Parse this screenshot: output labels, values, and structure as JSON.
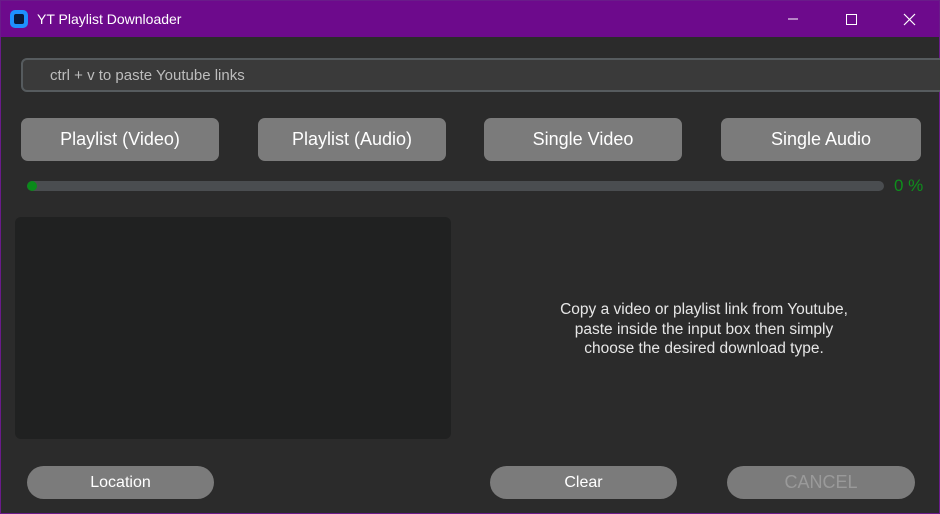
{
  "window": {
    "title": "YT Playlist Downloader",
    "icon": "app-icon",
    "controls": [
      "minimize-icon",
      "maximize-icon",
      "close-icon"
    ],
    "accent_color": "#6d0a8c"
  },
  "url_input": {
    "value": "",
    "placeholder": "ctrl + v to paste Youtube links"
  },
  "download_types": {
    "playlist_video": "Playlist (Video)",
    "playlist_audio": "Playlist (Audio)",
    "single_video": "Single Video",
    "single_audio": "Single Audio"
  },
  "progress": {
    "value": 0,
    "label": "0 %",
    "color": "#0a8a1a"
  },
  "instructions": {
    "line1": "Copy a video or playlist link from Youtube,",
    "line2": "paste inside the input box then simply",
    "line3": "choose the desired download type."
  },
  "bottom_buttons": {
    "location": "Location",
    "clear": "Clear",
    "cancel": "CANCEL"
  }
}
